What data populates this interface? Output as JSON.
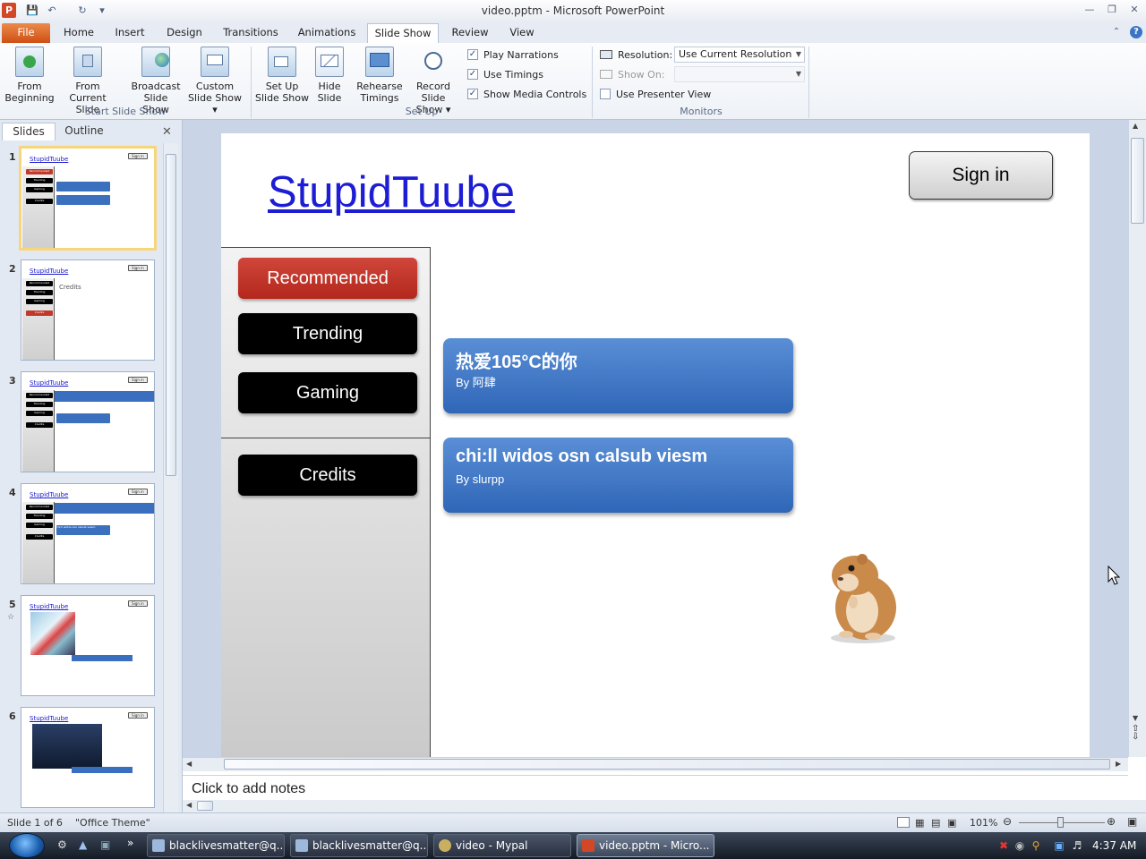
{
  "window": {
    "title": "video.pptm - Microsoft PowerPoint"
  },
  "ribbon_tabs": [
    "File",
    "Home",
    "Insert",
    "Design",
    "Transitions",
    "Animations",
    "Slide Show",
    "Review",
    "View"
  ],
  "ribbon": {
    "from_beginning": [
      "From",
      "Beginning"
    ],
    "from_current": [
      "From",
      "Current Slide"
    ],
    "broadcast": [
      "Broadcast",
      "Slide Show"
    ],
    "custom": [
      "Custom",
      "Slide Show ▾"
    ],
    "setup_show": [
      "Set Up",
      "Slide Show"
    ],
    "hide_slide": [
      "Hide",
      "Slide"
    ],
    "rehearse": [
      "Rehearse",
      "Timings"
    ],
    "record": [
      "Record Slide",
      "Show ▾"
    ],
    "play_narrations": "Play Narrations",
    "use_timings": "Use Timings",
    "show_media_controls": "Show Media Controls",
    "resolution_label": "Resolution:",
    "resolution_value": "Use Current Resolution",
    "show_on_label": "Show On:",
    "use_presenter_view": "Use Presenter View",
    "groups": {
      "start": "Start Slide Show",
      "setup": "Set Up",
      "monitors": "Monitors"
    }
  },
  "left_pane": {
    "tabs": [
      "Slides",
      "Outline"
    ],
    "thumbnails": [
      {
        "num": "1"
      },
      {
        "num": "2"
      },
      {
        "num": "3"
      },
      {
        "num": "4"
      },
      {
        "num": "5"
      },
      {
        "num": "6"
      }
    ],
    "thumb_title": "StupidTuube",
    "thumb_sign": "Sign in",
    "thumb_nav": [
      "Recommended",
      "Trending",
      "Gaming",
      "Credits"
    ],
    "thumb2_text": "Credits",
    "thumb4_card": "chi:ll widos osn calsub viesm"
  },
  "slide": {
    "title": "StupidTuube",
    "sign_in": "Sign in",
    "nav": [
      "Recommended",
      "Trending",
      "Gaming",
      "Credits"
    ],
    "cards": [
      {
        "title": "热爱105°C的你",
        "by": "By 阿肆"
      },
      {
        "title": "chi:ll widos osn calsub viesm",
        "by": "By slurpp"
      }
    ]
  },
  "notes_placeholder": "Click to add notes",
  "status": {
    "slide": "Slide 1 of 6",
    "theme": "\"Office Theme\"",
    "zoom": "101%"
  },
  "taskbar": {
    "items": [
      "blacklivesmatter@q...",
      "blacklivesmatter@q...",
      "video - Mypal",
      "video.pptm - Micro..."
    ],
    "clock": "4:37 AM"
  },
  "colors": {
    "accent": "#2f66b7",
    "file_tab": "#d2581f",
    "title_link": "#1d1dd6",
    "red_button": "#c0392b"
  }
}
